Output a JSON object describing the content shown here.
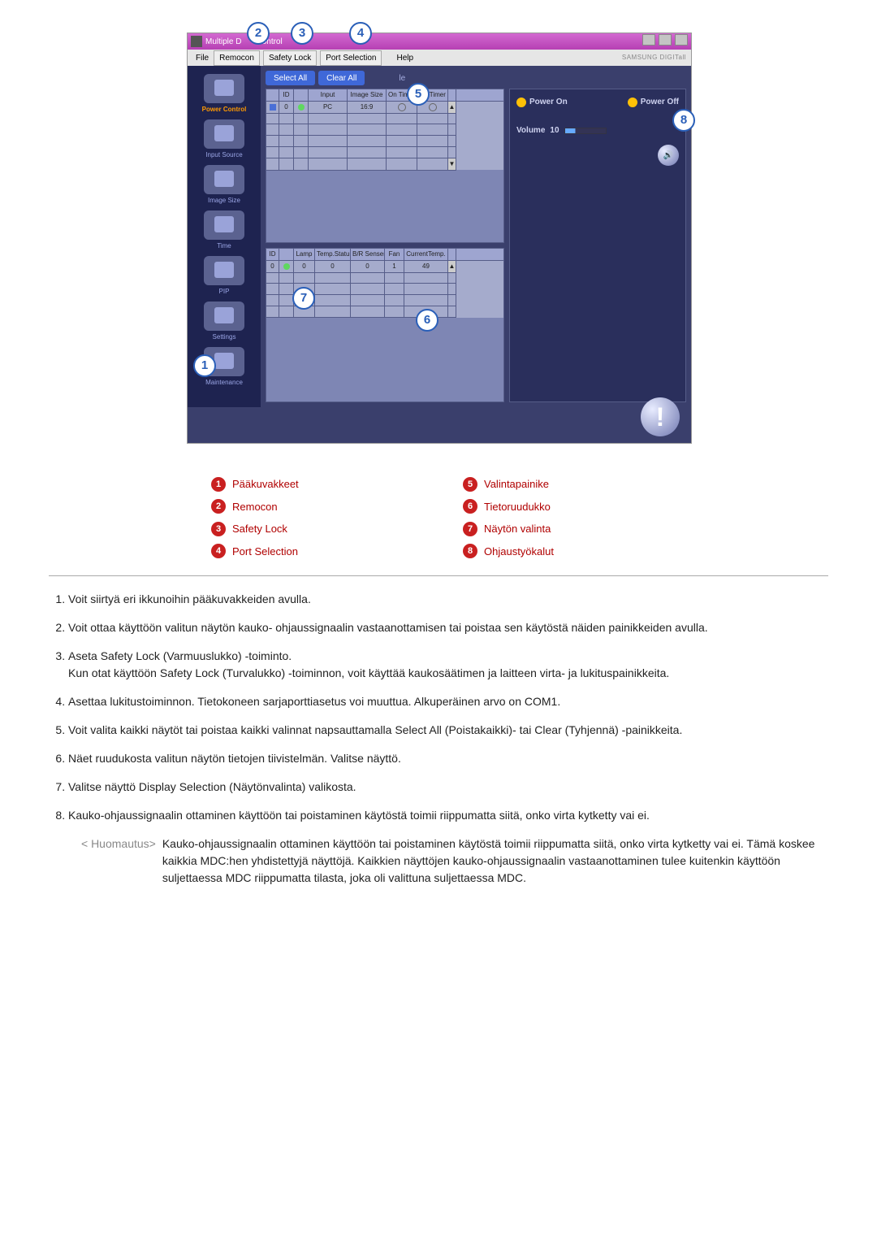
{
  "window": {
    "title_left": "Multiple D",
    "title_mid": "Control",
    "brand": "SAMSUNG DIGITall"
  },
  "menubar": {
    "file": "File",
    "remocon": "Remocon",
    "safety": "Safety Lock",
    "port": "Port Selection",
    "help": "Help"
  },
  "sidebar": {
    "power": "Power Control",
    "input": "Input Source",
    "image": "Image Size",
    "time": "Time",
    "pip": "PIP",
    "settings": "Settings",
    "maint": "Maintenance"
  },
  "toolbar": {
    "select": "Select All",
    "clear": "Clear All",
    "suffix": "le"
  },
  "grid_upper": {
    "headers": [
      "",
      "ID",
      "",
      "Input",
      "Image Size",
      "On Timer",
      "Off Timer",
      ""
    ],
    "row": [
      "",
      "0",
      "",
      "PC",
      "16:9",
      "",
      "",
      ""
    ]
  },
  "grid_lower": {
    "headers": [
      "ID",
      "",
      "Lamp",
      "Temp.Status",
      "B/R Senser",
      "Fan",
      "CurrentTemp.",
      ""
    ],
    "row": [
      "0",
      "",
      "0",
      "0",
      "0",
      "1",
      "49",
      ""
    ]
  },
  "right": {
    "power_on": "Power On",
    "power_off": "Power Off",
    "volume": "Volume",
    "volume_val": "10"
  },
  "legend": {
    "i1": "Pääkuvakkeet",
    "i2": "Remocon",
    "i3": "Safety Lock",
    "i4": "Port Selection",
    "i5": "Valintapainike",
    "i6": "Tietoruudukko",
    "i7": "Näytön valinta",
    "i8": "Ohjaustyökalut"
  },
  "list": {
    "n1": "Voit siirtyä eri ikkunoihin pääkuvakkeiden avulla.",
    "n2": "Voit ottaa käyttöön valitun näytön kauko- ohjaussignaalin vastaanottamisen tai poistaa sen käytöstä näiden painikkeiden avulla.",
    "n3a": "Aseta Safety Lock (Varmuuslukko) -toiminto.",
    "n3b": "Kun otat käyttöön Safety Lock (Turvalukko) -toiminnon, voit käyttää kaukosäätimen ja laitteen virta- ja lukituspainikkeita.",
    "n4": "Asettaa lukitustoiminnon. Tietokoneen sarjaporttiasetus voi muuttua. Alkuperäinen arvo on COM1.",
    "n5": "Voit valita kaikki näytöt tai poistaa kaikki valinnat napsauttamalla Select All (Poistakaikki)- tai Clear (Tyhjennä) -painikkeita.",
    "n6": "Näet ruudukosta valitun näytön tietojen tiivistelmän. Valitse näyttö.",
    "n7": "Valitse näyttö Display Selection (Näytönvalinta) valikosta.",
    "n8": "Kauko-ohjaussignaalin ottaminen käyttöön tai poistaminen käytöstä toimii riippumatta siitä, onko virta kytketty vai ei."
  },
  "note": {
    "label": "< Huomautus>",
    "text": "Kauko-ohjaussignaalin ottaminen käyttöön tai poistaminen käytöstä toimii riippumatta siitä, onko virta kytketty vai ei. Tämä koskee kaikkia MDC:hen yhdistettyjä näyttöjä. Kaikkien näyttöjen kauko-ohjaussignaalin vastaanottaminen tulee kuitenkin käyttöön suljettaessa MDC riippumatta tilasta, joka oli valittuna suljettaessa MDC."
  },
  "callouts": {
    "c1": "1",
    "c2": "2",
    "c3": "3",
    "c4": "4",
    "c5": "5",
    "c6": "6",
    "c7": "7",
    "c8": "8"
  }
}
